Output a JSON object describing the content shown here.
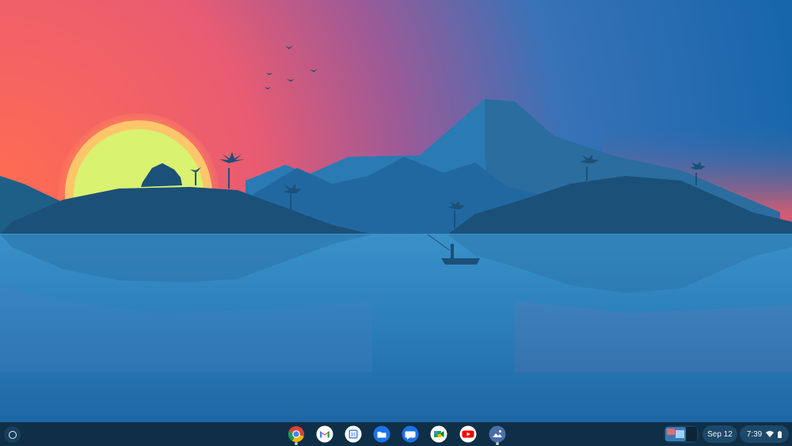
{
  "shelf": {
    "apps": [
      {
        "name": "chrome-app-icon",
        "running": true
      },
      {
        "name": "gmail-app-icon",
        "running": false
      },
      {
        "name": "calendar-app-icon",
        "running": false,
        "badge": "31"
      },
      {
        "name": "files-app-icon",
        "running": false
      },
      {
        "name": "messages-app-icon",
        "running": false
      },
      {
        "name": "meet-app-icon",
        "running": false
      },
      {
        "name": "youtube-app-icon",
        "running": false
      },
      {
        "name": "camera-app-icon",
        "running": true
      }
    ],
    "status": {
      "date": "Sep 12",
      "time": "7:39"
    }
  },
  "colors": {
    "shelf_bg": "#0f2f47",
    "sky_top": "#1c6fb2",
    "sunset_red": "#ef5b5f",
    "sun": "#d9f26f",
    "lake": "#2b80bd"
  }
}
